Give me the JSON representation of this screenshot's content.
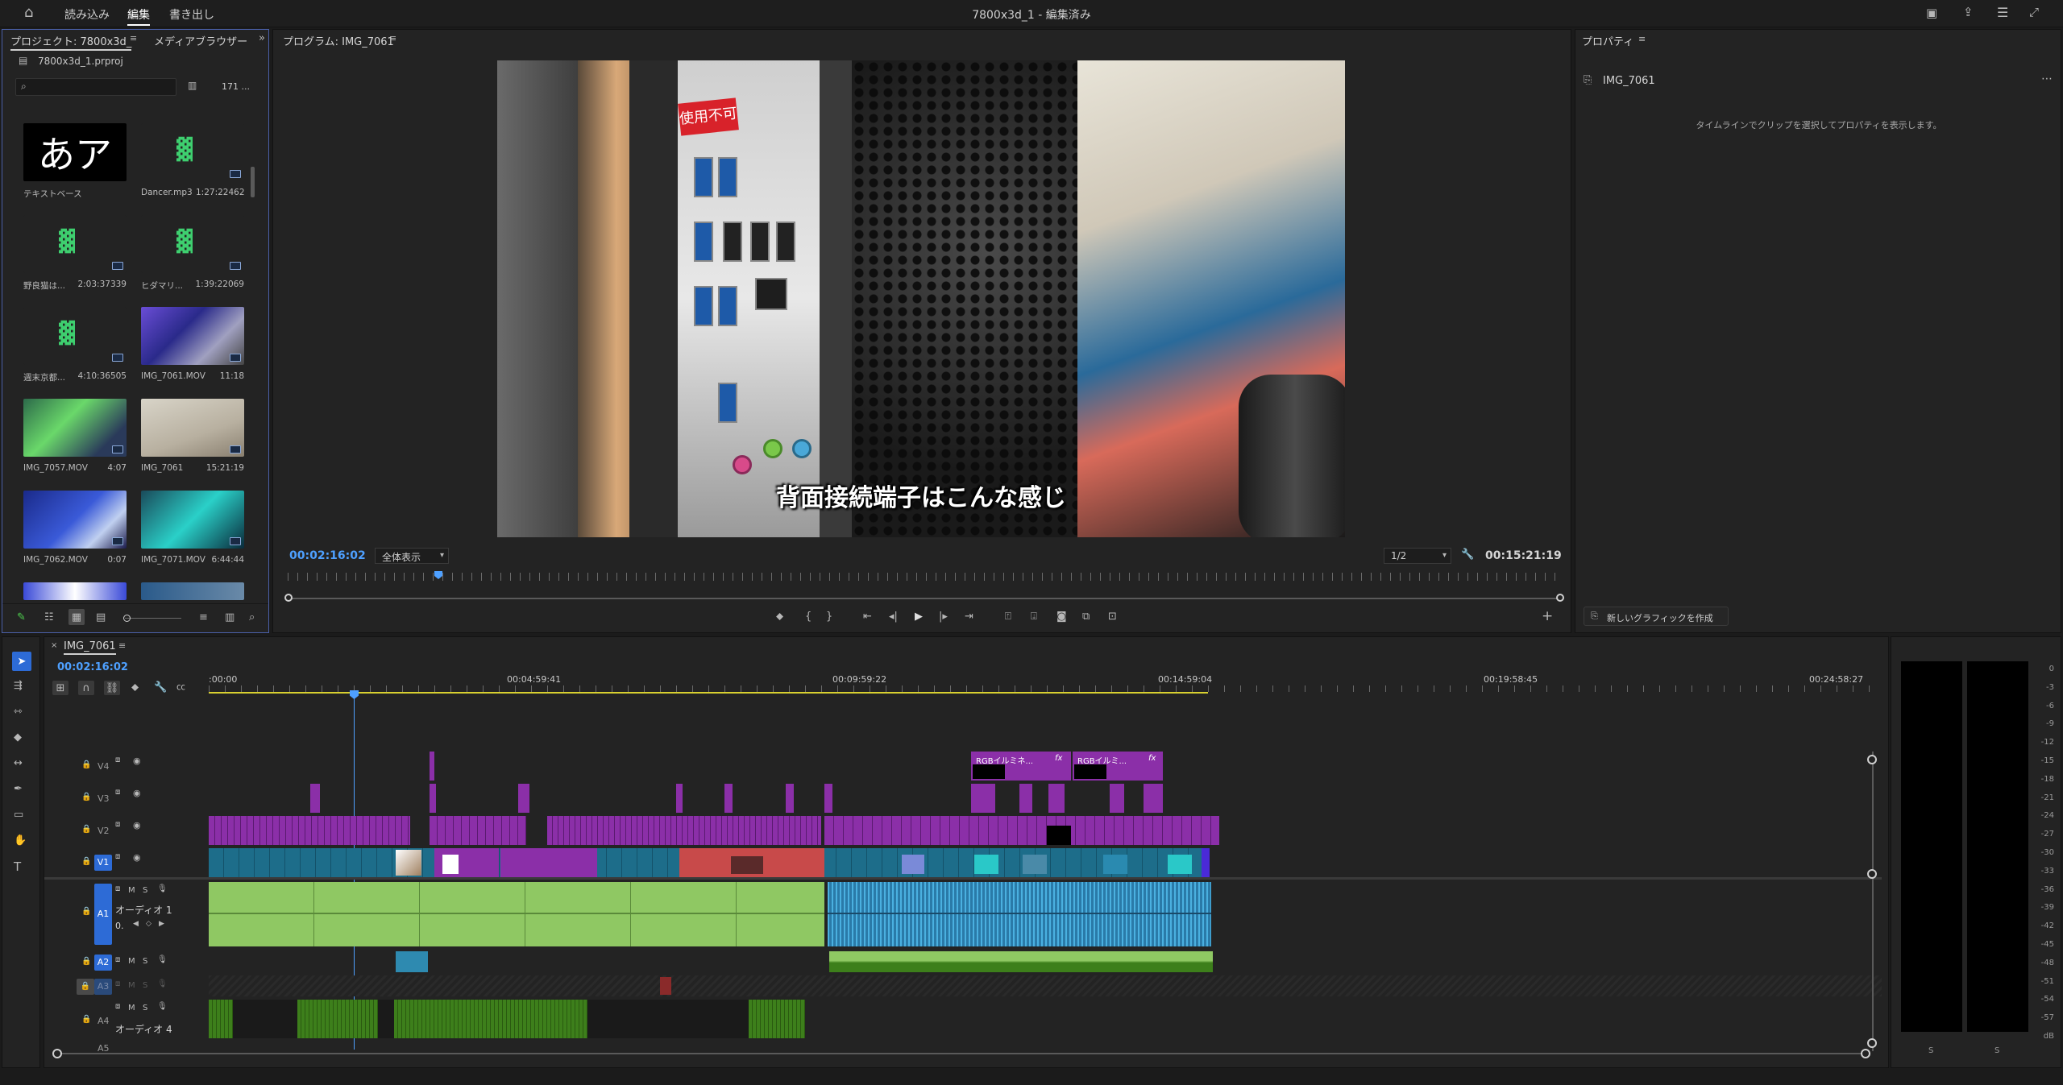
{
  "app": {
    "title": "7800x3d_1 - 編集済み",
    "nav": [
      "読み込み",
      "編集",
      "書き出し"
    ],
    "active_nav": "編集"
  },
  "project": {
    "tab_project": "プロジェクト: 7800x3d_",
    "tab_media": "メディアブラウザー",
    "file": "7800x3d_1.prproj",
    "search_placeholder": "",
    "count": "171 ...",
    "items": [
      {
        "name": "テキストベース",
        "duration": "",
        "kind": "text",
        "thumb_text": "あア"
      },
      {
        "name": "Dancer.mp3",
        "duration": "1:27:22462",
        "kind": "audio"
      },
      {
        "name": "野良猫は...",
        "duration": "2:03:37339",
        "kind": "audio"
      },
      {
        "name": "ヒダマリ...",
        "duration": "1:39:22069",
        "kind": "audio"
      },
      {
        "name": "週末京都...",
        "duration": "4:10:36505",
        "kind": "audio"
      },
      {
        "name": "IMG_7061.MOV",
        "duration": "11:18",
        "kind": "video"
      },
      {
        "name": "IMG_7057.MOV",
        "duration": "4:07",
        "kind": "video"
      },
      {
        "name": "IMG_7061",
        "duration": "15:21:19",
        "kind": "video"
      },
      {
        "name": "IMG_7062.MOV",
        "duration": "0:07",
        "kind": "video"
      },
      {
        "name": "IMG_7071.MOV",
        "duration": "6:44:44",
        "kind": "video"
      }
    ]
  },
  "program": {
    "title": "プログラム: IMG_7061",
    "timecode": "00:02:16:02",
    "zoom": "全体表示",
    "quality": "1/2",
    "duration": "00:15:21:19",
    "subtitle": "背面接続端子はこんな感じ",
    "sticker": "使用不可"
  },
  "properties": {
    "title": "プロパティ",
    "clip_name": "IMG_7061",
    "hint": "タイムラインでクリップを選択してプロパティを表示します。",
    "new_graphic": "新しいグラフィックを作成"
  },
  "timeline": {
    "sequence": "IMG_7061",
    "timecode": "00:02:16:02",
    "ruler": [
      ":00:00",
      "00:04:59:41",
      "00:09:59:22",
      "00:14:59:04",
      "00:19:58:45",
      "00:24:58:27"
    ],
    "tracks_video": [
      "V4",
      "V3",
      "V2",
      "V1"
    ],
    "tracks_audio": [
      "A1",
      "A2",
      "A3",
      "A4",
      "A5"
    ],
    "a1_name": "オーディオ 1",
    "a4_name": "オーディオ 4",
    "a1_value": "0.",
    "rgb_clip": "RGBイルミネ...",
    "rgb_clip2": "RGBイルミ..."
  },
  "meter": {
    "scale": [
      "0",
      "-3",
      "-6",
      "-9",
      "-12",
      "-15",
      "-18",
      "-21",
      "-24",
      "-27",
      "-30",
      "-33",
      "-36",
      "-39",
      "-42",
      "-45",
      "-48",
      "-51",
      "-54",
      "-57",
      "dB"
    ],
    "solo_left": "S",
    "solo_right": "S"
  },
  "colors": {
    "accent": "#4ea0ff",
    "video_clip": "#8b2fa8",
    "audio_clip": "#8fc863",
    "audio_dark": "#3d7f1b",
    "track_target": "#2d6bd6"
  }
}
